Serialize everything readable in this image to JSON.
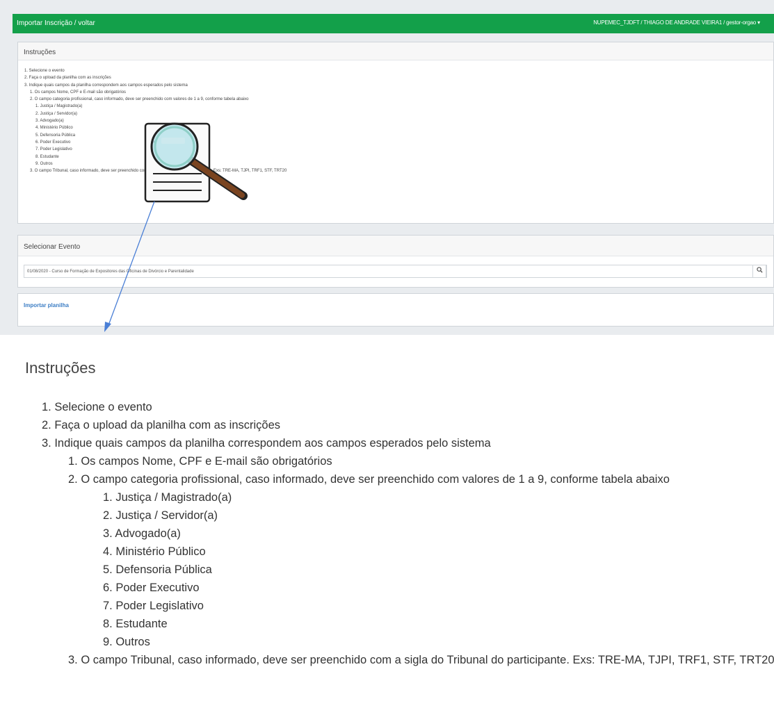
{
  "header": {
    "breadcrumb": "Importar Inscrição / voltar",
    "user_info": "NUPEMEC_TJDFT / THIAGO DE ANDRADE VIEIRA1 / gestor-orgao",
    "user_menu_arrow": "▾"
  },
  "instructions_panel": {
    "title": "Instruções"
  },
  "instructions": {
    "title": "Instruções",
    "items": [
      "1. Selecione o evento",
      "2. Faça o upload da planilha com as inscrições",
      "3. Indique quais campos da planilha correspondem aos campos esperados pelo sistema",
      "1. Os campos Nome, CPF e E-mail são obrigatórios",
      "2. O campo categoria profissional, caso informado, deve ser preenchido com valores de 1 a 9, conforme tabela abaixo",
      "1. Justiça / Magistrado(a)",
      "2. Justiça / Servidor(a)",
      "3. Advogado(a)",
      "4. Ministério Público",
      "5. Defensoria Pública",
      "6. Poder Executivo",
      "7. Poder Legislativo",
      "8. Estudante",
      "9. Outros",
      "3. O campo Tribunal, caso informado, deve ser preenchido com a sigla do Tribunal do participante. Exs: TRE-MA, TJPI, TRF1, STF, TRT20"
    ],
    "levels": [
      1,
      1,
      1,
      2,
      2,
      3,
      3,
      3,
      3,
      3,
      3,
      3,
      3,
      3,
      2
    ]
  },
  "event_panel": {
    "title": "Selecionar Evento",
    "selected_event": "01/08/2020 - Curso de Formação de Expositores das Oficinas de Divórcio e Parentalidade",
    "search_icon": "search-icon"
  },
  "import_panel": {
    "link_label": "Importar planilha"
  },
  "colors": {
    "header_green": "#13a04a",
    "link_blue": "#3b7dc4",
    "magnifier_handle": "#7a4420"
  },
  "icons": {
    "magnifier": "magnifier-document-icon"
  }
}
